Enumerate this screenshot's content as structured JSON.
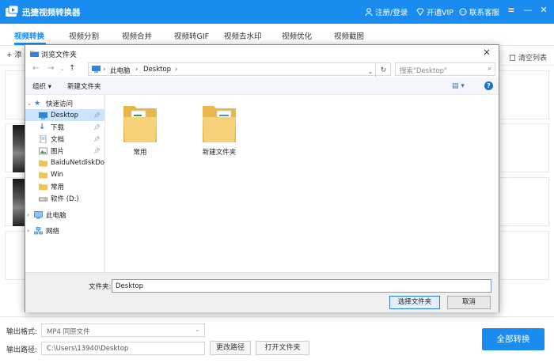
{
  "app": {
    "title": "迅捷视频转换器",
    "register_login": "注册/登录",
    "vip": "开通VIP",
    "support": "联系客服"
  },
  "tabs": [
    {
      "label": "视频转换",
      "active": true
    },
    {
      "label": "视频分割"
    },
    {
      "label": "视频合并"
    },
    {
      "label": "视频转GIF"
    },
    {
      "label": "视频去水印"
    },
    {
      "label": "视频优化"
    },
    {
      "label": "视频截图"
    }
  ],
  "toolbar": {
    "add_label": "+ 添",
    "clear_list": "清空列表"
  },
  "bottom": {
    "format_label": "输出格式:",
    "format_value": "MP4  同原文件",
    "path_label": "输出路径:",
    "path_value": "C:\\Users\\13940\\Desktop",
    "change_path": "更改路径",
    "open_folder": "打开文件夹",
    "convert_all": "全部转换"
  },
  "dialog": {
    "title": "浏览文件夹",
    "address": [
      "此电脑",
      "Desktop"
    ],
    "search_placeholder": "搜索\"Desktop\"",
    "organize": "组织 ▾",
    "new_folder": "新建文件夹",
    "nav": [
      {
        "label": "快速访问",
        "icon": "star-icon"
      },
      {
        "label": "Desktop",
        "icon": "desktop-icon",
        "selected": true,
        "pinned": true
      },
      {
        "label": "下载",
        "icon": "download-icon",
        "pinned": true
      },
      {
        "label": "文档",
        "icon": "document-icon",
        "pinned": true
      },
      {
        "label": "图片",
        "icon": "picture-icon",
        "pinned": true
      },
      {
        "label": "BaiduNetdiskDow",
        "icon": "folder-icon"
      },
      {
        "label": "Win",
        "icon": "folder-icon"
      },
      {
        "label": "常用",
        "icon": "folder-icon"
      },
      {
        "label": "软件 (D:)",
        "icon": "drive-icon"
      },
      {
        "label": "此电脑",
        "icon": "computer-icon"
      },
      {
        "label": "网络",
        "icon": "network-icon"
      }
    ],
    "folders": [
      {
        "label": "常用"
      },
      {
        "label": "新建文件夹"
      }
    ],
    "filename_label": "文件夹:",
    "filename_value": "Desktop",
    "select_button": "选择文件夹",
    "cancel_button": "取消"
  },
  "colors": {
    "brand": "#1a8cf0",
    "selection": "#cce4fb"
  }
}
